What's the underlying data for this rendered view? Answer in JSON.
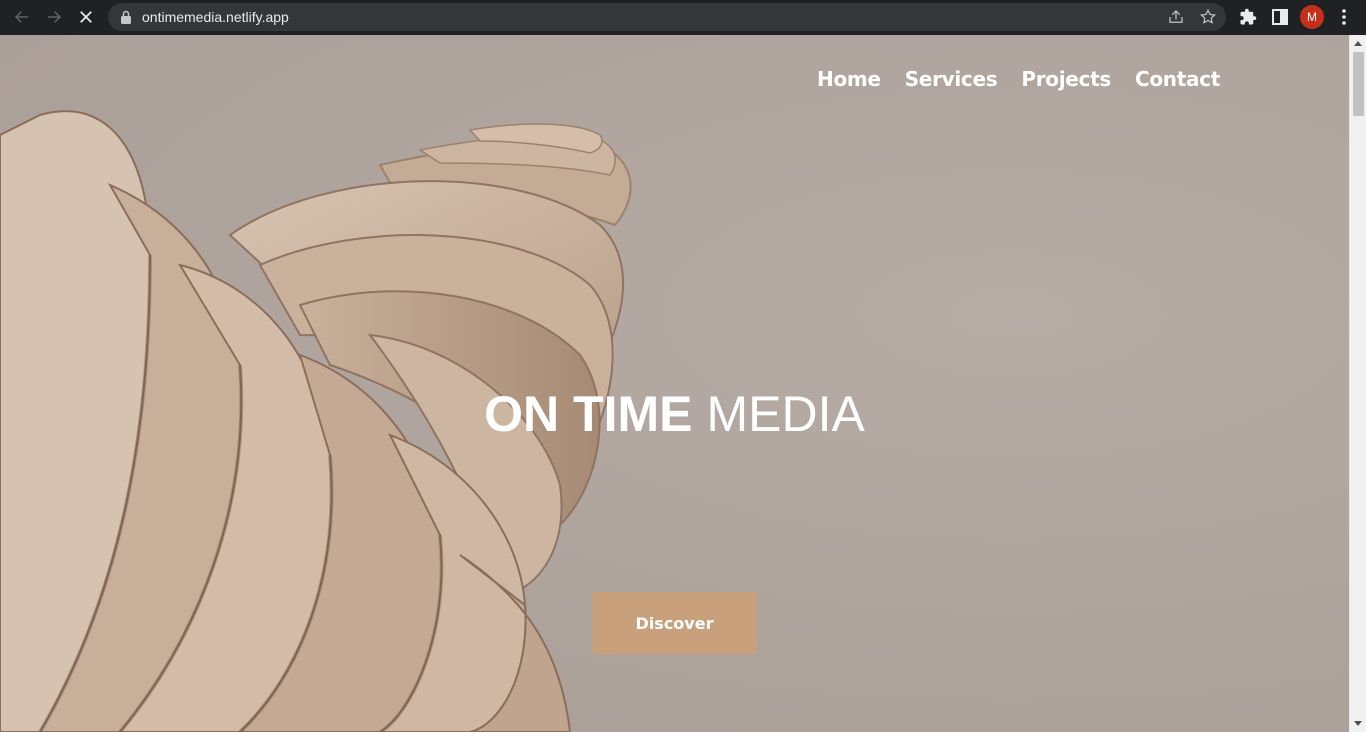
{
  "browser": {
    "url": "ontimemedia.netlify.app",
    "profile_initial": "M",
    "profile_color": "#c4301a",
    "icons": {
      "back": "arrow-left-icon",
      "forward": "arrow-right-icon",
      "stop": "close-icon",
      "lock": "lock-icon",
      "share": "share-icon",
      "bookmark": "star-icon",
      "extensions": "puzzle-icon",
      "side_panel": "side-panel-icon",
      "menu": "kebab-menu-icon"
    }
  },
  "site": {
    "nav": [
      {
        "label": "Home"
      },
      {
        "label": "Services"
      },
      {
        "label": "Projects"
      },
      {
        "label": "Contact"
      }
    ],
    "hero": {
      "title_bold": "ON TIME",
      "title_light": "MEDIA",
      "cta_label": "Discover"
    },
    "colors": {
      "background": "#aea39c",
      "cta": "#c8a07b",
      "text": "#ffffff"
    }
  }
}
